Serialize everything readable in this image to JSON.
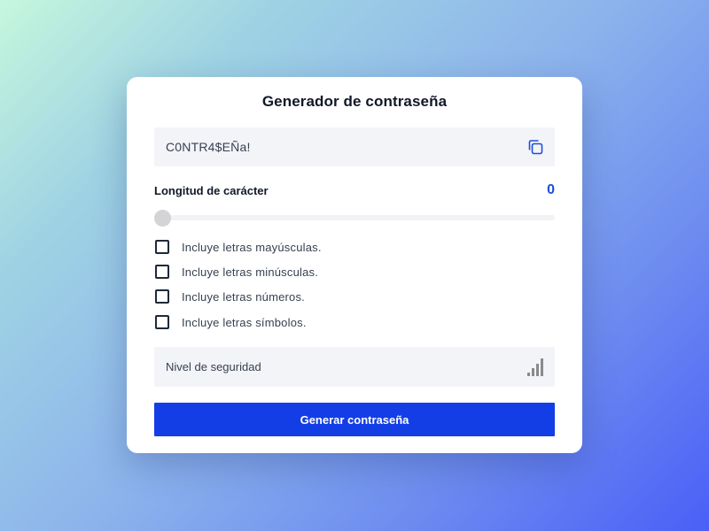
{
  "generator": {
    "title": "Generador de contraseña",
    "password_value": "C0NTR4$EÑa!",
    "length_label": "Longitud de carácter",
    "length_value": "0",
    "options": [
      {
        "label": "Incluye letras mayúsculas.",
        "checked": false
      },
      {
        "label": "Incluye letras minúsculas.",
        "checked": false
      },
      {
        "label": "Incluye letras números.",
        "checked": false
      },
      {
        "label": "Incluye letras símbolos.",
        "checked": false
      }
    ],
    "strength_label": "Nivel de seguridad",
    "generate_label": "Generar contraseña"
  },
  "icons": {
    "copy": "copy-icon",
    "signal": "signal-strength-icon"
  },
  "colors": {
    "accent": "#133ee6",
    "length_value": "#1d4ed8",
    "copy_icon": "#1d4ed8",
    "signal_icon": "#8a8a8a"
  }
}
